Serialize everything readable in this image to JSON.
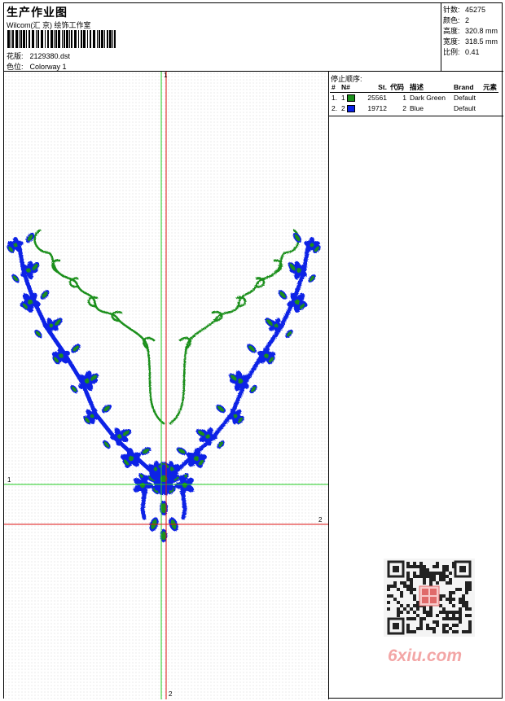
{
  "header": {
    "title": "生产作业图",
    "company": "Wilcom(汇 京) 绘饰工作室",
    "design_label": "花版:",
    "design_value": "2129380.dst",
    "colorway_label": "色位:",
    "colorway_value": "Colorway 1"
  },
  "stats": [
    {
      "label": "针数:",
      "value": "45275"
    },
    {
      "label": "颜色:",
      "value": "2"
    },
    {
      "label": "高度:",
      "value": "320.8 mm"
    },
    {
      "label": "宽度:",
      "value": "318.5 mm"
    },
    {
      "label": "比例:",
      "value": "0.41"
    }
  ],
  "stop_sequence": {
    "title": "停止顺序:",
    "columns": [
      "#",
      "N#",
      "St.",
      "代码",
      "描述",
      "Brand",
      "元素"
    ],
    "rows": [
      {
        "idx": "1.",
        "n": "1",
        "color": "#1a8f1a",
        "st": "25561",
        "code": "1",
        "desc": "Dark Green",
        "brand": "Default",
        "elem": ""
      },
      {
        "idx": "2.",
        "n": "2",
        "color": "#0a22e6",
        "st": "19712",
        "code": "2",
        "desc": "Blue",
        "brand": "Default",
        "elem": ""
      }
    ]
  },
  "guides": {
    "v_green_label": "1",
    "h_green_label": "1",
    "h_red_label": "2",
    "v_red_label": "2"
  },
  "colors": {
    "green_thread": "#1a8f1a",
    "blue_thread": "#0a22e6",
    "guide_green": "#22cc22",
    "guide_red": "#dd1111"
  },
  "watermark": "6xiu.com"
}
